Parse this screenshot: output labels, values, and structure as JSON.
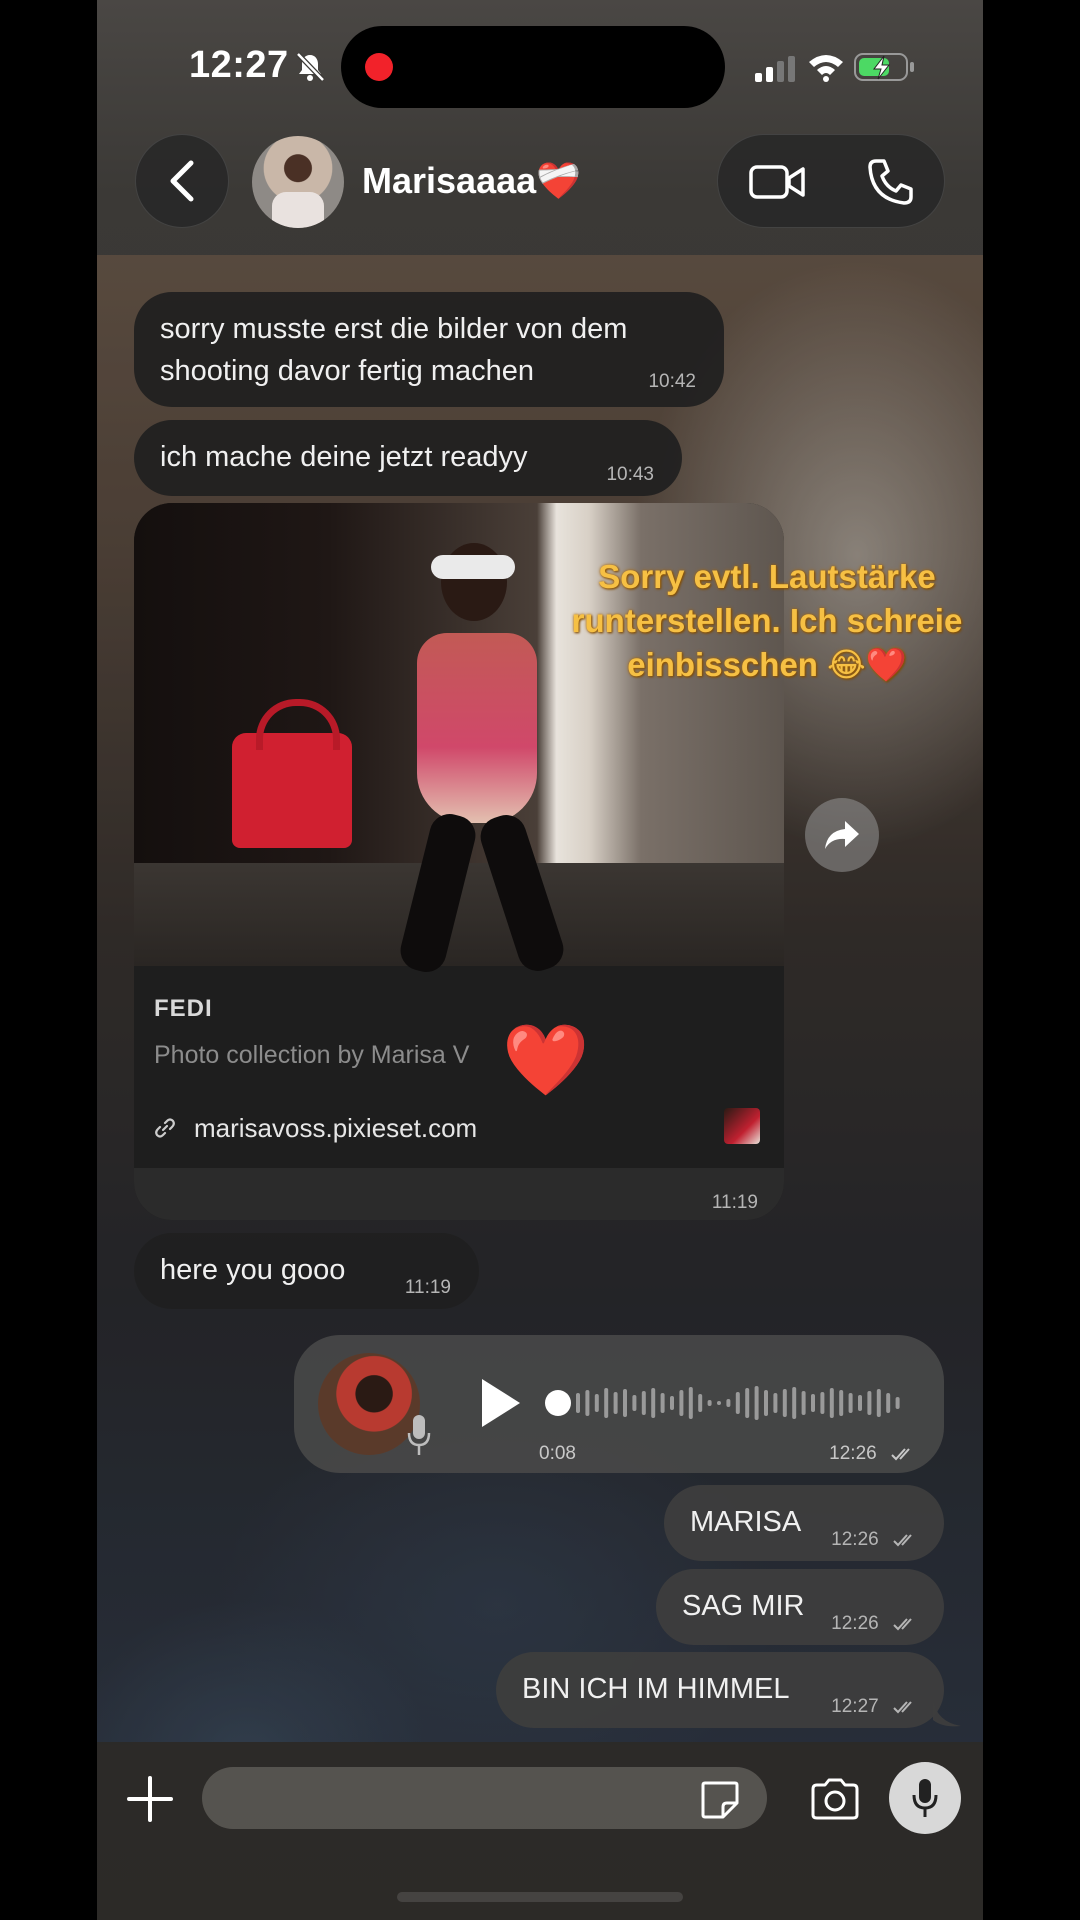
{
  "status": {
    "time": "12:27"
  },
  "header": {
    "contact_name": "Marisaaaa❤️‍🩹"
  },
  "messages": [
    {
      "text": "sorry musste erst die bilder von dem shooting davor fertig machen",
      "time": "10:42"
    },
    {
      "text": "ich mache deine jetzt readyy",
      "time": "10:43"
    },
    {
      "text": "here you gooo",
      "time": "11:19"
    }
  ],
  "link_preview": {
    "title": "FEDI",
    "description": "Photo collection by Marisa V",
    "url": "marisavoss.pixieset.com",
    "time": "11:19"
  },
  "overlay_caption": "Sorry evtl. Lautstärke runterstellen. Ich schreie einbisschen 😂❤️",
  "sticker_heart": "❤️",
  "voice_message": {
    "duration": "0:08",
    "time": "12:26"
  },
  "outgoing": [
    {
      "text": "MARISA",
      "time": "12:26"
    },
    {
      "text": "SAG MIR",
      "time": "12:26"
    },
    {
      "text": "BIN ICH IM HIMMEL",
      "time": "12:27"
    }
  ],
  "colors": {
    "overlay_text": "#f6c044",
    "record_dot": "#f2222a",
    "battery_charge": "#4cd964"
  }
}
